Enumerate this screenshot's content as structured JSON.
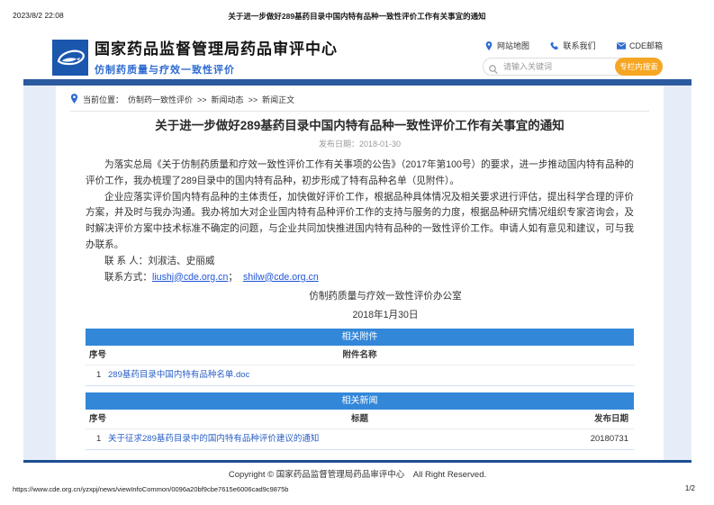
{
  "print": {
    "timestamp": "2023/8/2 22:08",
    "doc_title": "关于进一步做好289基药目录中国内特有品种一致性评价工作有关事宜的通知",
    "url": "https://www.cde.org.cn/yzxpj/news/viewInfoCommon/0096a20bf9cbe7615e6006cad9c9875b",
    "page_indicator": "1/2"
  },
  "header": {
    "site_title": "国家药品监督管理局药品审评中心",
    "site_subtitle": "仿制药质量与疗效一致性评价",
    "links": [
      {
        "label": "网站地图",
        "icon": "map-pin-icon"
      },
      {
        "label": "联系我们",
        "icon": "phone-icon"
      },
      {
        "label": "CDE邮箱",
        "icon": "mail-icon"
      }
    ],
    "search": {
      "placeholder": "请输入关键词",
      "button_label": "专栏内搜索"
    }
  },
  "breadcrumb": {
    "prefix": "当前位置：",
    "separator": ">>",
    "items": [
      "仿制药一致性评价",
      "新闻动态",
      "新闻正文"
    ]
  },
  "article": {
    "title": "关于进一步做好289基药目录中国内特有品种一致性评价工作有关事宜的通知",
    "publish_date": "发布日期：2018-01-30",
    "paragraphs": [
      "为落实总局《关于仿制药质量和疗效一致性评价工作有关事项的公告》（2017年第100号）的要求，进一步推动国内特有品种的评价工作，我办梳理了289目录中的国内特有品种，初步形成了特有品种名单（见附件）。",
      "企业应落实评价国内特有品种的主体责任，加快做好评价工作，根据品种具体情况及相关要求进行评估，提出科学合理的评价方案，并及时与我办沟通。我办将加大对企业国内特有品种评价工作的支持与服务的力度，根据品种研究情况组织专家咨询会，及时解决评价方案中技术标准不确定的问题，与企业共同加快推进国内特有品种的一致性评价工作。申请人如有意见和建议，可与我办联系。"
    ],
    "contact_person": "联 系 人：刘淑洁、史丽威",
    "contact_label": "联系方式：",
    "email_separator": "；",
    "emails": [
      "liushj@cde.org.cn",
      "shilw@cde.org.cn"
    ],
    "signature_org": "仿制药质量与疗效一致性评价办公室",
    "signature_date": "2018年1月30日"
  },
  "attachments_table": {
    "title": "相关附件",
    "columns": [
      "序号",
      "附件名称"
    ],
    "rows": [
      {
        "seq": "1",
        "name": "289基药目录中国内特有品种名单.doc"
      }
    ]
  },
  "news_table": {
    "title": "相关新闻",
    "columns": [
      "序号",
      "标题",
      "发布日期"
    ],
    "rows": [
      {
        "seq": "1",
        "title": "关于征求289基药目录中的国内特有品种评价建议的通知",
        "date": "20180731"
      }
    ]
  },
  "footer": {
    "copyright": "Copyright © 国家药品监督管理局药品审评中心　All Right Reserved."
  },
  "colors": {
    "navbar_blue": "#2b5a9e",
    "table_header_blue": "#3287d9",
    "page_background_blue": "#e7edf8",
    "logo_blue": "#1b57ad",
    "accent_orange": "#f6a623",
    "link_blue": "#2b5fc4",
    "bottom_rule_blue": "#1d4e92"
  }
}
